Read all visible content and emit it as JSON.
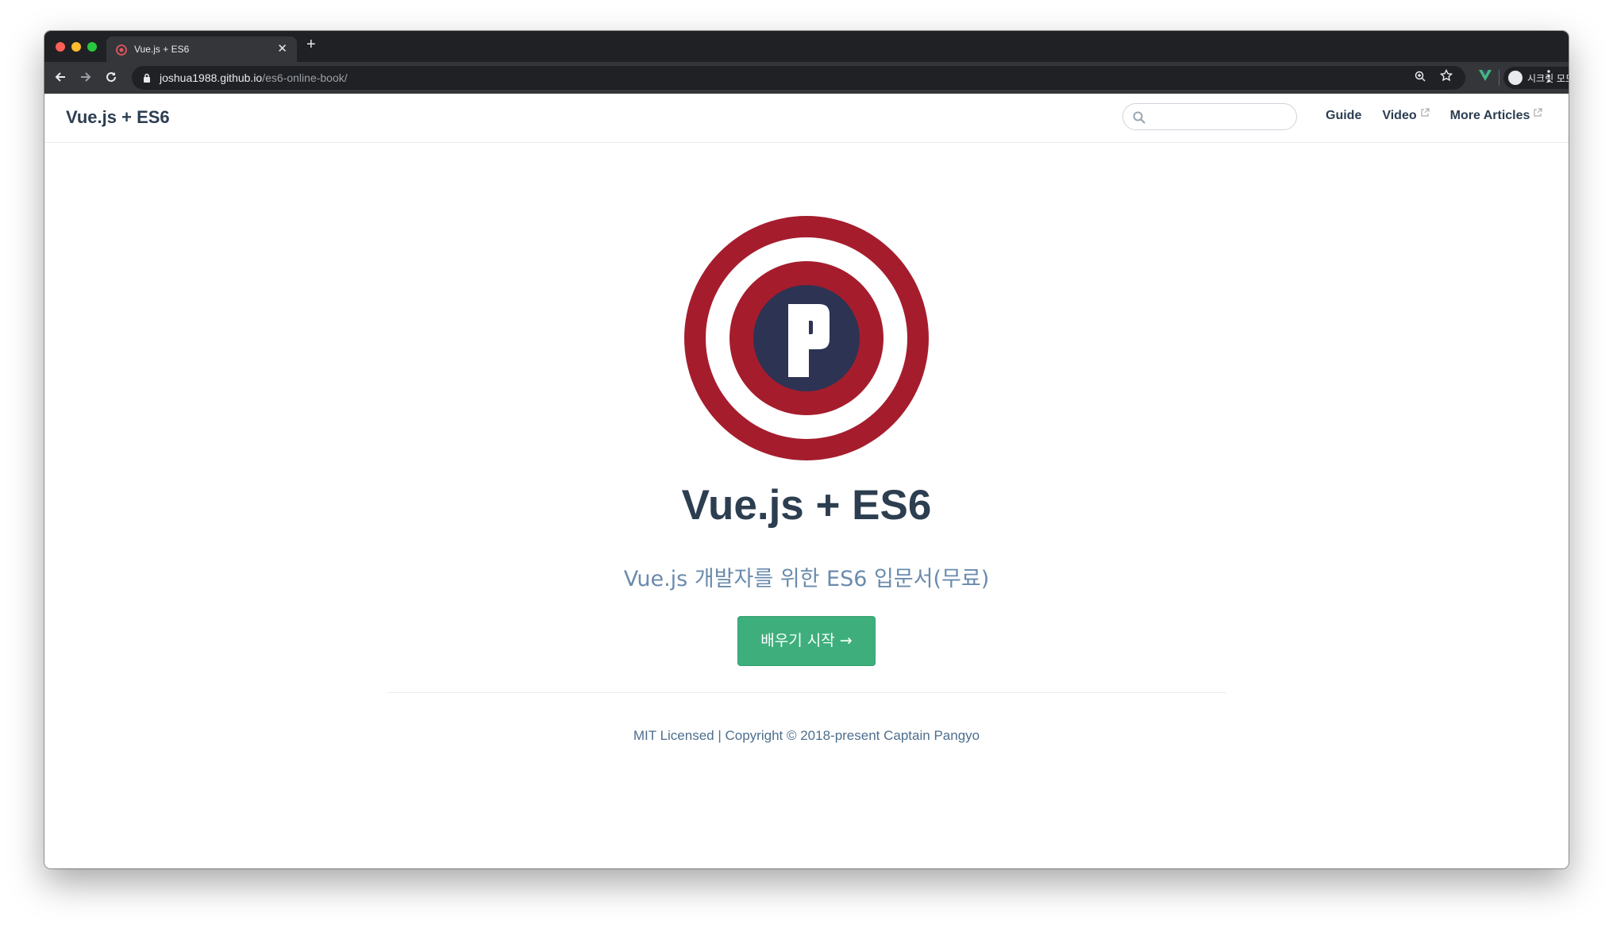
{
  "browser": {
    "tab_title": "Vue.js + ES6",
    "tab_close": "✕",
    "new_tab": "+",
    "url_host": "joshua1988.github.io",
    "url_path": "/es6-online-book/",
    "incognito_label": "시크릿 모드",
    "icons": {
      "back": "arrow-left-icon",
      "forward": "arrow-right-icon",
      "reload": "reload-icon",
      "lock": "lock-icon",
      "zoom": "zoom-icon",
      "bookmark": "star-icon",
      "extension": "vue-devtools-icon",
      "incognito": "incognito-icon",
      "menu": "kebab-menu-icon"
    }
  },
  "site": {
    "title": "Vue.js + ES6",
    "search_placeholder": "",
    "nav": [
      {
        "label": "Guide",
        "external": false
      },
      {
        "label": "Video",
        "external": true
      },
      {
        "label": "More Articles",
        "external": true
      }
    ]
  },
  "hero": {
    "logo": "captain-pangyo-logo",
    "title": "Vue.js + ES6",
    "description": "Vue.js 개발자를 위한 ES6 입문서(무료)",
    "action_label": "배우기 시작 →"
  },
  "footer": {
    "text": "MIT Licensed | Copyright © 2018-present Captain Pangyo"
  },
  "colors": {
    "accent": "#3eaf7c",
    "text": "#2c3e50",
    "description": "#6a8bad",
    "logo_red": "#a51d2d",
    "logo_navy": "#2d3353"
  }
}
